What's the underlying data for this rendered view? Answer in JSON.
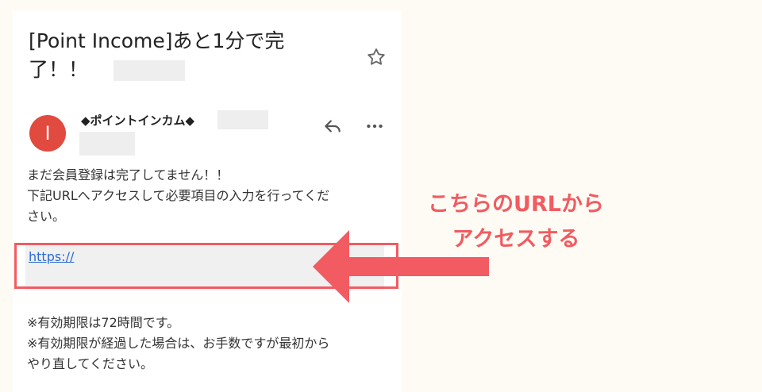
{
  "email": {
    "subject_line1": "[Point Income]あと1分で完",
    "subject_line2": "了！！",
    "sender_name": "◆ポイントインカム◆",
    "avatar_letter": "I",
    "body_line1": "まだ会員登録は完了してません！！",
    "body_line2": "下記URLへアクセスして必要項目の入力を行ってくだ",
    "body_line3": "さい。",
    "link_text": "https://",
    "footer_line1": "※有効期限は72時間です。",
    "footer_line2": "※有効期限が経過した場合は、お手数ですが最初から",
    "footer_line3": "やり直してください。"
  },
  "annotation": {
    "line1": "こちらのURLから",
    "line2": "アクセスする",
    "color": "#f15b61"
  },
  "icons": [
    "star-icon",
    "reply-icon",
    "more-icon"
  ]
}
